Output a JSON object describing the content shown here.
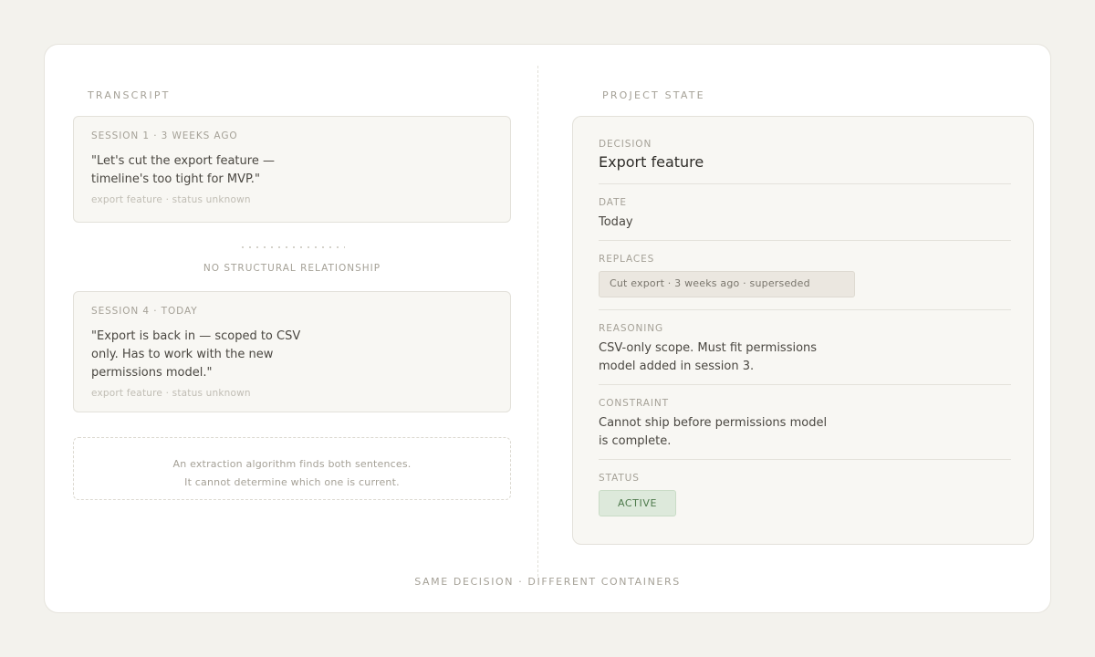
{
  "transcript": {
    "label": "TRANSCRIPT",
    "sessions": [
      {
        "title": "SESSION 1 · 3 WEEKS AGO",
        "quote": "\"Let's cut the export feature — timeline's too tight for MVP.\"",
        "meta": "export feature · status unknown"
      },
      {
        "title": "SESSION 4 · TODAY",
        "quote": "\"Export is back in — scoped to CSV only. Has to work with the new permissions model.\"",
        "meta": "export feature · status unknown"
      }
    ],
    "relationship": "NO STRUCTURAL RELATIONSHIP",
    "note": {
      "line1": "An extraction algorithm finds both sentences.",
      "line2": "It cannot determine which one is current."
    }
  },
  "project_state": {
    "label": "PROJECT STATE",
    "decision": {
      "label": "DECISION",
      "value": "Export feature"
    },
    "date": {
      "label": "DATE",
      "value": "Today"
    },
    "replaces": {
      "label": "REPLACES",
      "value": "Cut export · 3 weeks ago · superseded"
    },
    "reasoning": {
      "label": "REASONING",
      "value": "CSV-only scope. Must fit permissions model added in session 3."
    },
    "constraint": {
      "label": "CONSTRAINT",
      "value": "Cannot ship before permissions model is complete."
    },
    "status": {
      "label": "STATUS",
      "value": "ACTIVE",
      "color": "#4e7a4c"
    }
  },
  "footer": "SAME DECISION · DIFFERENT CONTAINERS"
}
